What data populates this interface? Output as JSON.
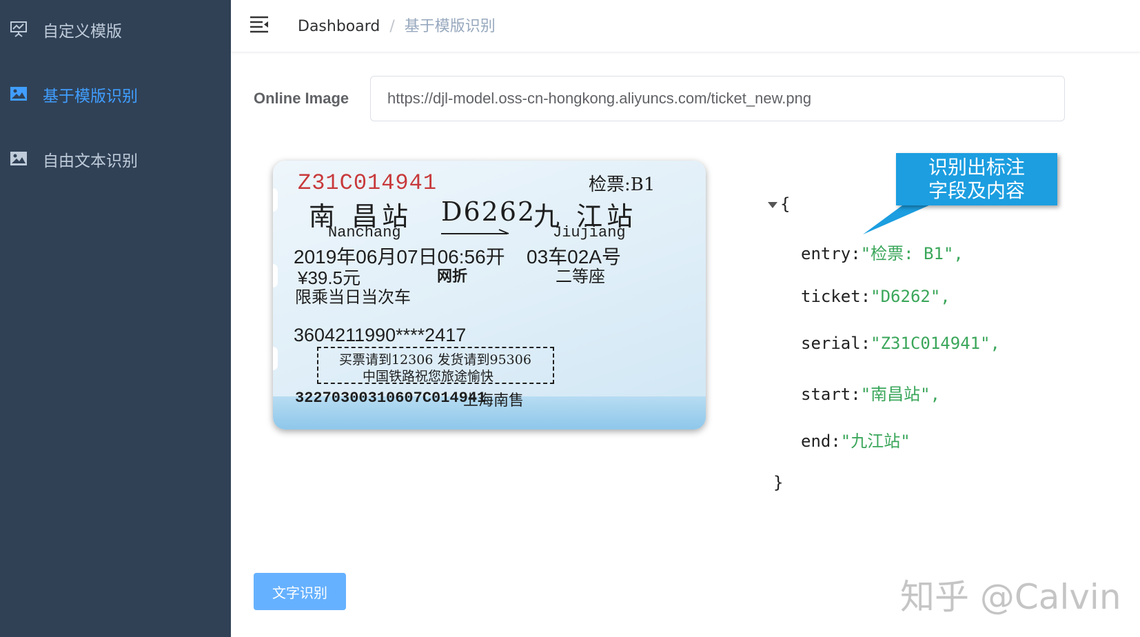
{
  "sidebar": {
    "items": [
      {
        "label": "自定义模版",
        "icon": "presentation-chart-icon",
        "active": false
      },
      {
        "label": "基于模版识别",
        "icon": "image-icon",
        "active": true
      },
      {
        "label": "自由文本识别",
        "icon": "image-icon",
        "active": false
      }
    ],
    "bg_color": "#304156",
    "active_color": "#409eff"
  },
  "header": {
    "menu_icon": "hamburger-fold-icon",
    "breadcrumb": {
      "home": "Dashboard",
      "separator": "/",
      "current": "基于模版识别"
    }
  },
  "form": {
    "label": "Online Image",
    "url_value": "https://djl-model.oss-cn-hongkong.aliyuncs.com/ticket_new.png"
  },
  "ticket": {
    "serial": "Z31C014941",
    "entry": "检票:B1",
    "from_station": "南 昌站",
    "train": "D6262",
    "to_station": "九 江站",
    "from_pinyin": "Nanchang",
    "to_pinyin": "Jiujiang",
    "datetime": "2019年06月07日06:56开",
    "seat": "03车02A号",
    "price": "¥39.5元",
    "discount": "网折",
    "class": "二等座",
    "limit": "限乘当日当次车",
    "id_number": "3604211990****2417",
    "notice_line1": "买票请到12306 发货请到95306",
    "notice_line2": "中国铁路祝您旅途愉快",
    "ticket_code": "32270300310607C014941",
    "office": "上海南售"
  },
  "callout": {
    "line1": "识别出标注",
    "line2": "字段及内容",
    "color": "#1c9ee0"
  },
  "json_result": {
    "open": "{",
    "close": "}",
    "fields": [
      {
        "key": "entry:",
        "value": "\"检票: B1\","
      },
      {
        "key": "ticket:",
        "value": "\"D6262\","
      },
      {
        "key": "serial:",
        "value": "\"Z31C014941\","
      },
      {
        "key": "start:",
        "value": "\"南昌站\","
      },
      {
        "key": "end:",
        "value": "\"九江站\""
      }
    ],
    "string_color": "#3aa65a"
  },
  "actions": {
    "recognize_label": "文字识别",
    "button_color": "#66b1ff"
  },
  "watermark": "知乎 @Calvin"
}
